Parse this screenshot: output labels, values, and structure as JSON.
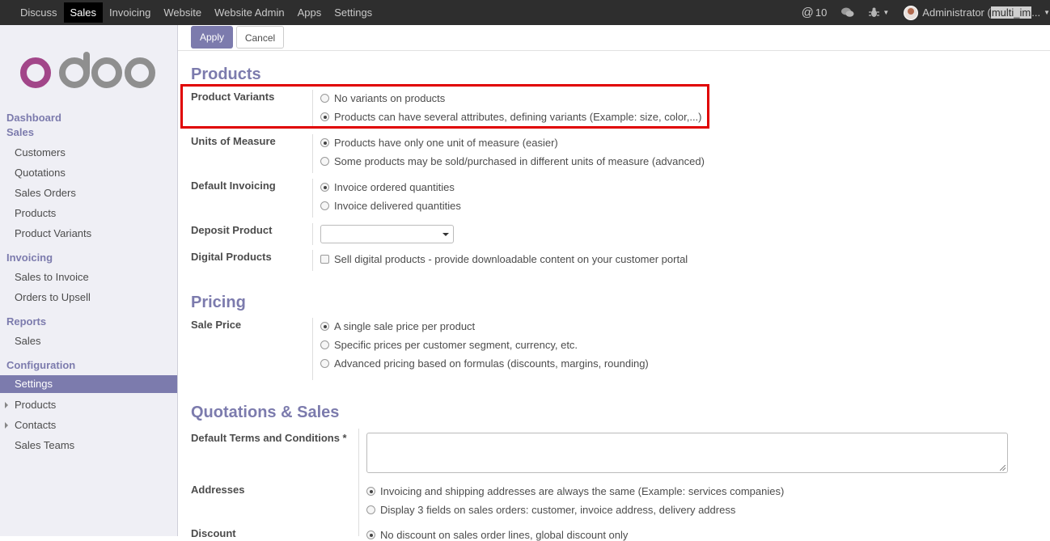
{
  "topbar": {
    "menu": [
      "Discuss",
      "Sales",
      "Invoicing",
      "Website",
      "Website Admin",
      "Apps",
      "Settings"
    ],
    "active": "Sales",
    "mentions_count": "10",
    "user_name": "Administrator (",
    "db_name": "multi_im",
    "db_suffix": "..."
  },
  "sidebar": {
    "dashboard": "Dashboard",
    "sales": "Sales",
    "sales_items": [
      "Customers",
      "Quotations",
      "Sales Orders",
      "Products",
      "Product Variants"
    ],
    "invoicing": "Invoicing",
    "invoicing_items": [
      "Sales to Invoice",
      "Orders to Upsell"
    ],
    "reports": "Reports",
    "reports_items": [
      "Sales"
    ],
    "configuration": "Configuration",
    "configuration_items": [
      "Settings",
      "Products",
      "Contacts",
      "Sales Teams"
    ],
    "active_item": "Settings"
  },
  "buttons": {
    "apply": "Apply",
    "cancel": "Cancel"
  },
  "products": {
    "title": "Products",
    "variants_label": "Product Variants",
    "variants_opt1": "No variants on products",
    "variants_opt2": "Products can have several attributes, defining variants (Example: size, color,...)",
    "uom_label": "Units of Measure",
    "uom_opt1": "Products have only one unit of measure (easier)",
    "uom_opt2": "Some products may be sold/purchased in different units of measure (advanced)",
    "invoicing_label": "Default Invoicing",
    "invoicing_opt1": "Invoice ordered quantities",
    "invoicing_opt2": "Invoice delivered quantities",
    "deposit_label": "Deposit Product",
    "deposit_value": "",
    "digital_label": "Digital Products",
    "digital_opt": "Sell digital products - provide downloadable content on your customer portal"
  },
  "pricing": {
    "title": "Pricing",
    "sale_price_label": "Sale Price",
    "opt1": "A single sale price per product",
    "opt2": "Specific prices per customer segment, currency, etc.",
    "opt3": "Advanced pricing based on formulas (discounts, margins, rounding)"
  },
  "quotations": {
    "title": "Quotations & Sales",
    "terms_label": "Default Terms and Conditions *",
    "addresses_label": "Addresses",
    "addr_opt1": "Invoicing and shipping addresses are always the same (Example: services companies)",
    "addr_opt2": "Display 3 fields on sales orders: customer, invoice address, delivery address",
    "discount_label": "Discount",
    "discount_opt1": "No discount on sales order lines, global discount only"
  },
  "colors": {
    "accent": "#7c7bad",
    "topbar": "#2e2e2e",
    "highlight": "#e00000"
  }
}
